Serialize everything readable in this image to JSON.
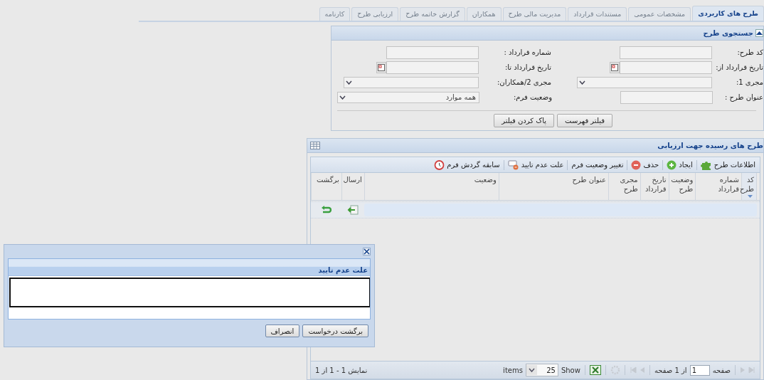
{
  "tabs": [
    {
      "label": "طرح های کاربردی",
      "selected": true,
      "disabled": false
    },
    {
      "label": "مشخصات عمومی",
      "selected": false,
      "disabled": true
    },
    {
      "label": "مستندات قرارداد",
      "selected": false,
      "disabled": true
    },
    {
      "label": "مدیریت مالی طرح",
      "selected": false,
      "disabled": true
    },
    {
      "label": "همکاران",
      "selected": false,
      "disabled": true
    },
    {
      "label": "گزارش خاتمه طرح",
      "selected": false,
      "disabled": true
    },
    {
      "label": "ارزیابی طرح",
      "selected": false,
      "disabled": true
    },
    {
      "label": "کارنامه",
      "selected": false,
      "disabled": true
    }
  ],
  "search_panel": {
    "title": "جستجوی طرح",
    "expanded": true,
    "fields": [
      {
        "label": "کد طرح:",
        "kind": "text"
      },
      {
        "label": "شماره قرارداد :",
        "kind": "text"
      },
      {
        "label": "تاریخ قرارداد از:",
        "kind": "date"
      },
      {
        "label": "تاریخ قرارداد تا:",
        "kind": "date"
      },
      {
        "label": "مجری 1:",
        "kind": "select"
      },
      {
        "label": "مجری 2/همکاران:",
        "kind": "select"
      },
      {
        "label": "عنوان طرح :",
        "kind": "text"
      },
      {
        "label": "وضعیت فرم:",
        "kind": "select",
        "value": "همه موارد"
      }
    ],
    "buttons": [
      "فیلتر فهرست",
      "پاک کردن فیلتر"
    ]
  },
  "grid": {
    "title": "طرح های رسیده جهت ارزیابی",
    "toolbar": [
      {
        "label": "اطلاعات طرح",
        "kind": "puzzle"
      },
      {
        "label": "ایجاد",
        "kind": "add"
      },
      {
        "label": "حذف",
        "kind": "delete"
      },
      {
        "label": "تغییر وضعیت فرم",
        "kind": "none"
      },
      {
        "label": "علت عدم تایید",
        "kind": "comment"
      },
      {
        "label": "سابقه گردش فرم",
        "kind": "history"
      }
    ],
    "columns": [
      {
        "label": "کد طرح",
        "sorted": true
      },
      {
        "label": "شماره قرارداد",
        "sorted": false
      },
      {
        "label": "وضعیت طرح",
        "sorted": false
      },
      {
        "label": "تاریخ قرارداد",
        "sorted": false
      },
      {
        "label": "مجری طرح",
        "sorted": false
      },
      {
        "label": "عنوان طرح",
        "sorted": false
      },
      {
        "label": "وضعیت",
        "sorted": false
      },
      {
        "label": "ارسال",
        "sorted": false
      },
      {
        "label": "برگشت",
        "sorted": false
      }
    ],
    "rows": [
      {
        "selected": true
      }
    ],
    "pager": {
      "page_label": "صفحه",
      "page": "1",
      "of_pages": "از 1 صفحه",
      "show_label": "Show",
      "page_size": "25",
      "items_label": "items",
      "summary": "نمایش 1 - 1 از 1"
    }
  },
  "dialog": {
    "section_title": "علت عدم تایید",
    "buttons": [
      "برگشت درخواست",
      "انصراف"
    ]
  }
}
